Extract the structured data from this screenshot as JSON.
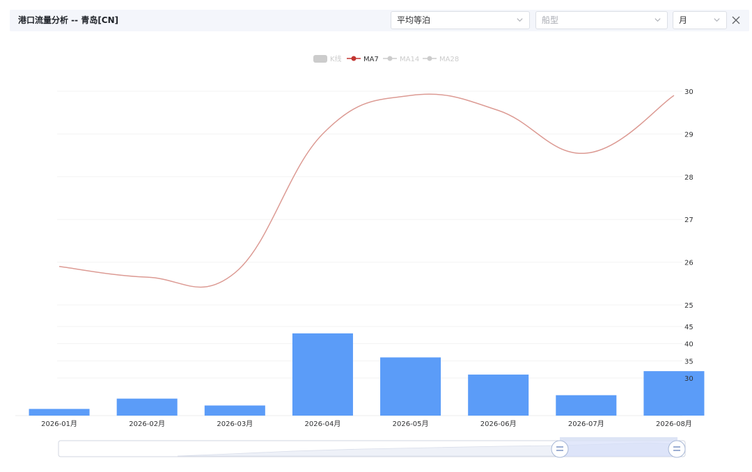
{
  "header": {
    "title": "港口流量分析 -- 青岛[CN]",
    "metric_select": "平均等泊",
    "ship_type_placeholder": "船型",
    "period_select": "月"
  },
  "legend": [
    {
      "label": "K线",
      "active": false
    },
    {
      "label": "MA7",
      "active": true
    },
    {
      "label": "MA14",
      "active": false
    },
    {
      "label": "MA28",
      "active": false
    }
  ],
  "colors": {
    "bar": "#5b9cf8",
    "ma7_line": "#dc9a93",
    "ma7_marker": "#c23531",
    "inactive": "#cccccc"
  },
  "chart_data": {
    "type": "bar+line",
    "categories": [
      "2026-01月",
      "2026-02月",
      "2026-03月",
      "2026-04月",
      "2026-05月",
      "2026-06月",
      "2026-07月",
      "2026-08月"
    ],
    "series": [
      {
        "name": "MA7",
        "type": "line",
        "axis": "upper",
        "values": [
          25.9,
          25.65,
          25.75,
          29.0,
          29.9,
          29.55,
          28.55,
          29.9
        ]
      },
      {
        "name": "K线",
        "type": "bar",
        "axis": "lower",
        "values": [
          21,
          24,
          22,
          43,
          36,
          31,
          25,
          32
        ]
      }
    ],
    "upper_axis": {
      "ticks": [
        25,
        26,
        27,
        28,
        29,
        30
      ],
      "position": "right"
    },
    "lower_axis": {
      "ticks": [
        30,
        35,
        40,
        45
      ],
      "position": "right"
    },
    "grid": true,
    "legend_position": "top-center"
  }
}
